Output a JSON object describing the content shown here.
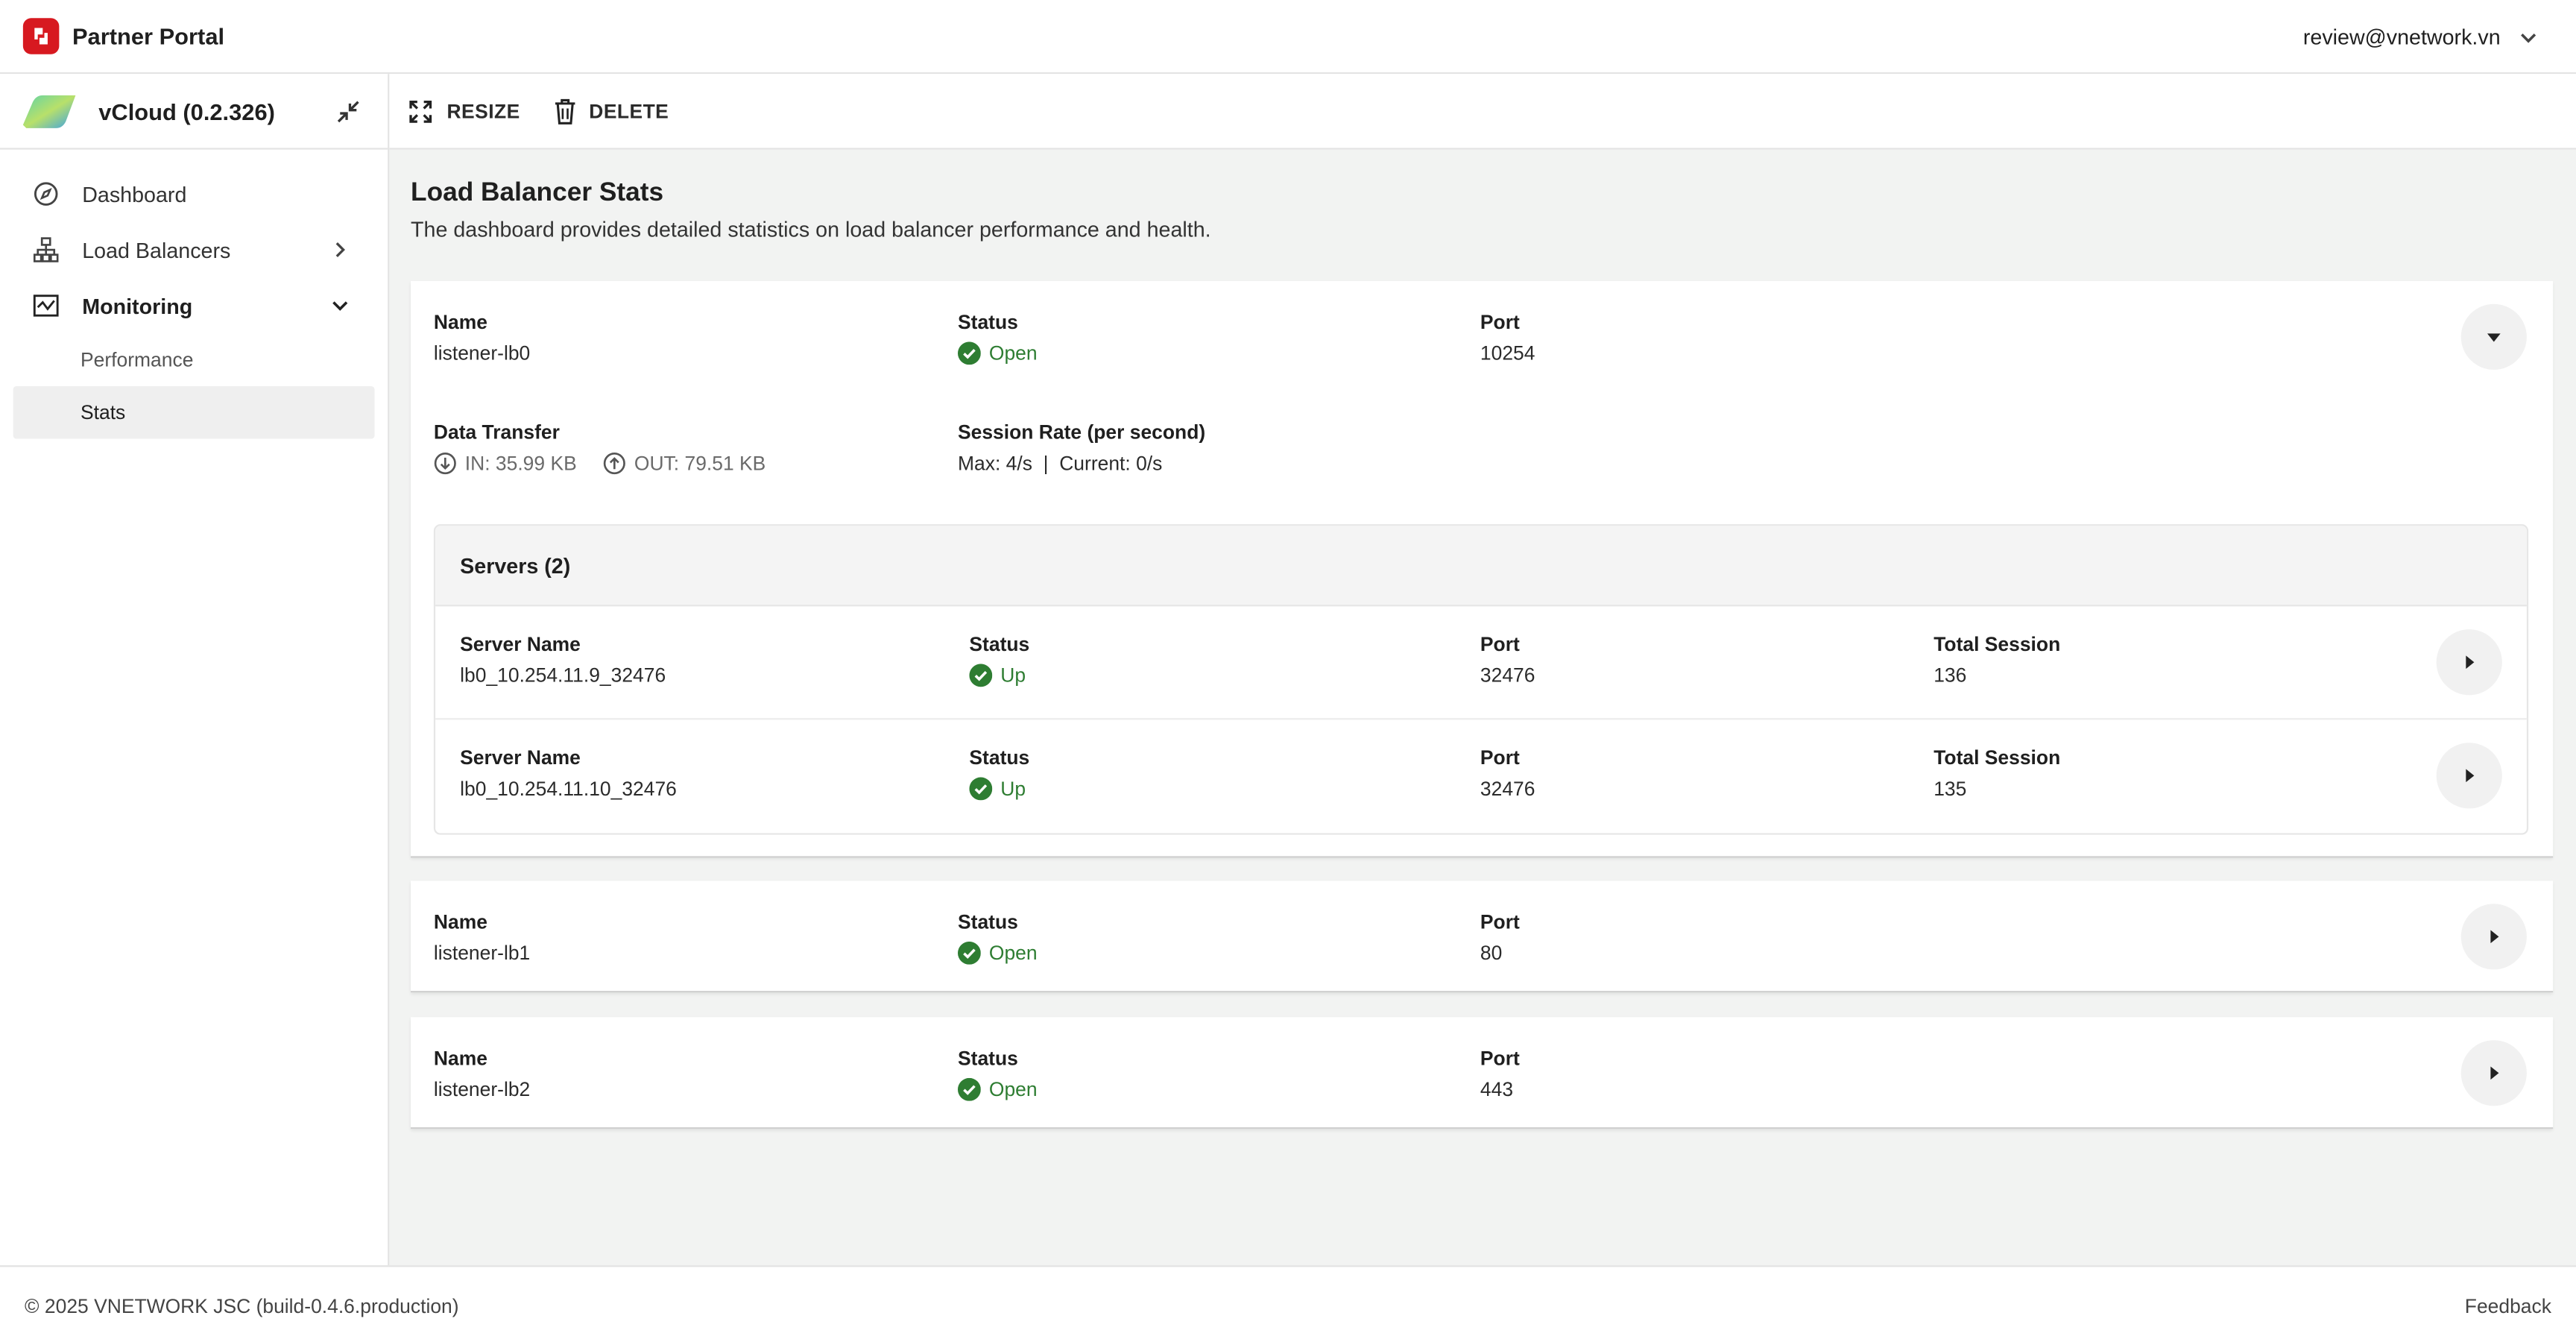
{
  "header": {
    "brand": "Partner Portal",
    "user_email": "review@vnetwork.vn"
  },
  "sidebar": {
    "project_name": "vCloud (0.2.326)",
    "items": [
      {
        "label": "Dashboard",
        "icon": "compass-icon"
      },
      {
        "label": "Load Balancers",
        "icon": "sitemap-icon"
      },
      {
        "label": "Monitoring",
        "icon": "monitoring-icon"
      }
    ],
    "monitoring_sub": [
      {
        "label": "Performance",
        "active": false
      },
      {
        "label": "Stats",
        "active": true
      }
    ]
  },
  "toolbar": {
    "resize_label": "RESIZE",
    "delete_label": "DELETE"
  },
  "page": {
    "title": "Load Balancer Stats",
    "description": "The dashboard provides detailed statistics on load balancer performance and health."
  },
  "labels": {
    "name": "Name",
    "status": "Status",
    "port": "Port",
    "data_transfer": "Data Transfer",
    "session_rate": "Session Rate (per second)",
    "server_name": "Server Name",
    "total_session": "Total Session"
  },
  "listeners": [
    {
      "name": "listener-lb0",
      "status": "Open",
      "port": "10254",
      "expanded": true,
      "data_in": "IN: 35.99 KB",
      "data_out": "OUT: 79.51 KB",
      "session_rate": "Max: 4/s  |  Current: 0/s",
      "servers_title": "Servers (2)",
      "servers": [
        {
          "name": "lb0_10.254.11.9_32476",
          "status": "Up",
          "port": "32476",
          "total_session": "136"
        },
        {
          "name": "lb0_10.254.11.10_32476",
          "status": "Up",
          "port": "32476",
          "total_session": "135"
        }
      ]
    },
    {
      "name": "listener-lb1",
      "status": "Open",
      "port": "80",
      "expanded": false
    },
    {
      "name": "listener-lb2",
      "status": "Open",
      "port": "443",
      "expanded": false
    }
  ],
  "footer": {
    "copyright": "© 2025 VNETWORK JSC (build-0.4.6.production)",
    "feedback": "Feedback"
  },
  "colors": {
    "brand": "#d71920",
    "status_ok": "#2e7d32",
    "main_bg": "#f2f3f2"
  }
}
